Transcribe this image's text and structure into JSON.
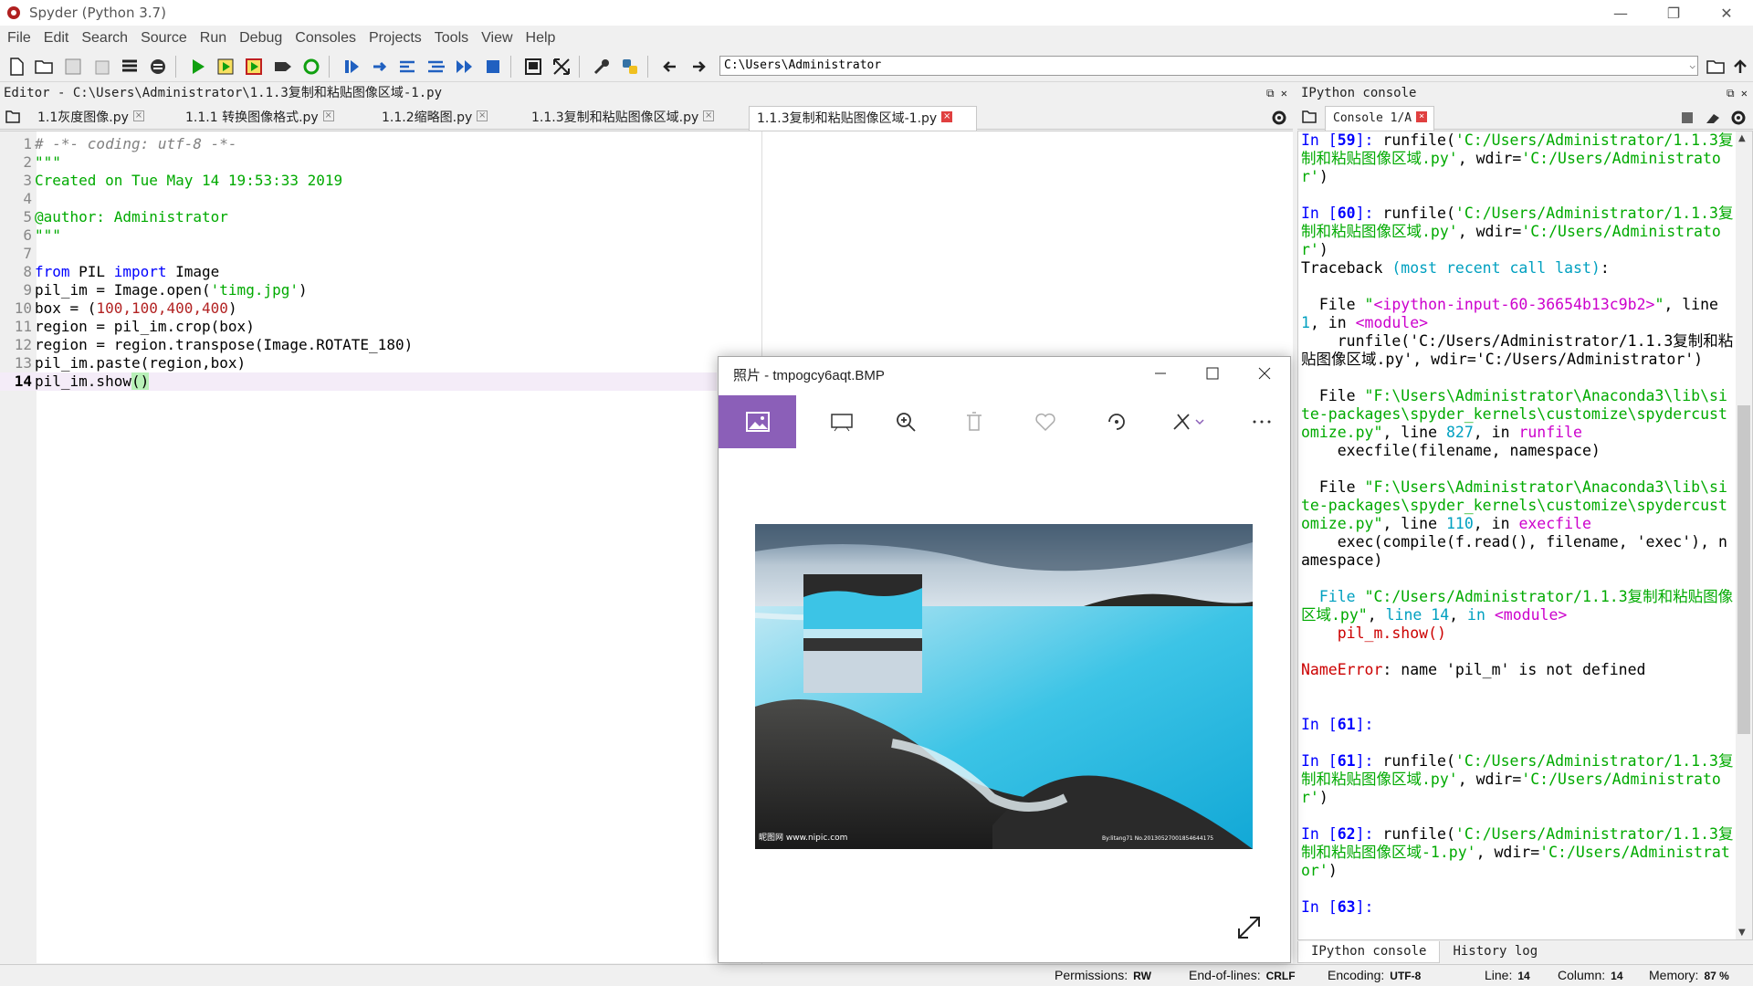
{
  "window": {
    "title": "Spyder (Python 3.7)"
  },
  "menu": [
    "File",
    "Edit",
    "Search",
    "Source",
    "Run",
    "Debug",
    "Consoles",
    "Projects",
    "Tools",
    "View",
    "Help"
  ],
  "path": {
    "value": "C:\\Users\\Administrator"
  },
  "editor": {
    "title": "Editor - C:\\Users\\Administrator\\1.1.3复制和粘贴图像区域-1.py",
    "tabs": [
      {
        "label": "1.1灰度图像.py"
      },
      {
        "label": "1.1.1 转换图像格式.py"
      },
      {
        "label": "1.1.2缩略图.py"
      },
      {
        "label": "1.1.3复制和粘贴图像区域.py"
      },
      {
        "label": "1.1.3复制和粘贴图像区域-1.py"
      }
    ],
    "lines": [
      {
        "n": "1",
        "text": "# -*- coding: utf-8 -*-"
      },
      {
        "n": "2",
        "text": "\"\"\""
      },
      {
        "n": "3",
        "text": "Created on Tue May 14 19:53:33 2019"
      },
      {
        "n": "4",
        "text": ""
      },
      {
        "n": "5",
        "text": "@author: Administrator"
      },
      {
        "n": "6",
        "text": "\"\"\""
      },
      {
        "n": "7",
        "text": ""
      },
      {
        "n": "8",
        "kw1": "from",
        "mid": " PIL ",
        "kw2": "import",
        "rest": " Image"
      },
      {
        "n": "9",
        "pre": "pil_im = Image.open(",
        "str": "'timg.jpg'",
        "post": ")"
      },
      {
        "n": "10",
        "pre": "box = (",
        "nums": "100,100,400,400",
        "post": ")"
      },
      {
        "n": "11",
        "text": "region = pil_im.crop(box)"
      },
      {
        "n": "12",
        "text": "region = region.transpose(Image.ROTATE_180)"
      },
      {
        "n": "13",
        "text": "pil_im.paste(region,box)"
      },
      {
        "n": "14",
        "pre": "pil_im.show",
        "paren": "()"
      }
    ]
  },
  "console": {
    "title": "IPython console",
    "tab": "Console 1/A",
    "bottom_tabs": [
      "IPython console",
      "History log"
    ]
  },
  "photos": {
    "title": "照片 - tmpogcy6aqt.BMP",
    "watermark_left": "昵图网 www.nipic.com",
    "watermark_right": "By:litang71 No.20130527001854644175"
  },
  "status": {
    "permissions_label": "Permissions:",
    "permissions": "RW",
    "eol_label": "End-of-lines:",
    "eol": "CRLF",
    "encoding_label": "Encoding:",
    "encoding": "UTF-8",
    "line_label": "Line:",
    "line": "14",
    "column_label": "Column:",
    "column": "14",
    "memory_label": "Memory:",
    "memory": "87 %"
  },
  "colors": {
    "accent": "#8b5fb8",
    "string": "#00aa00",
    "keyword": "#0000ff",
    "number": "#b22222"
  }
}
